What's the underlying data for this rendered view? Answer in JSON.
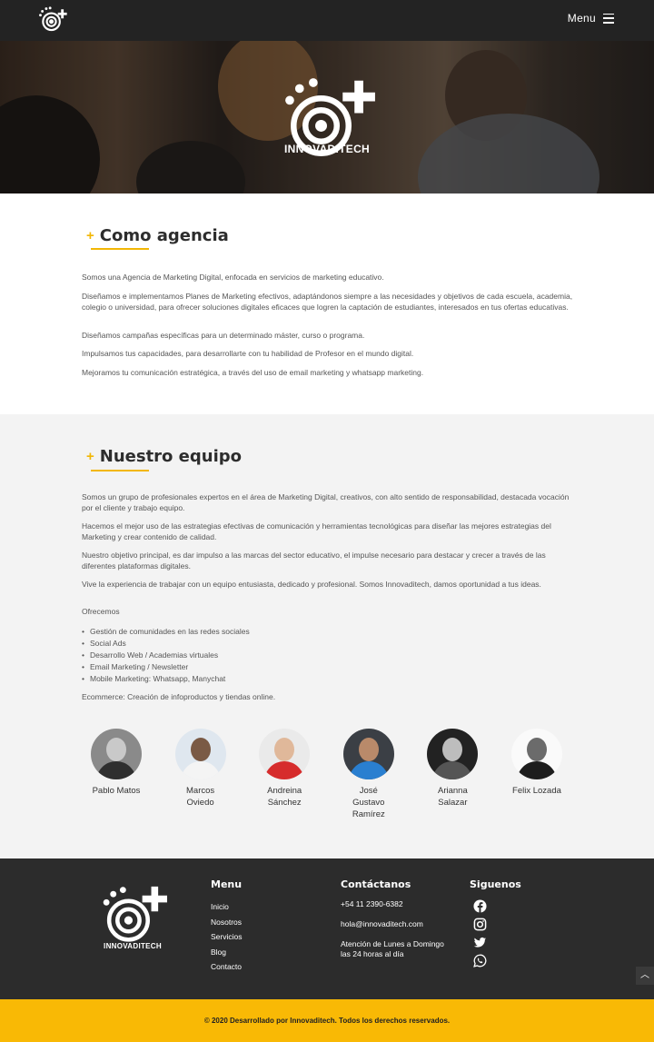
{
  "header": {
    "menu_label": "Menu"
  },
  "hero": {
    "brand": "INNOVADITECH"
  },
  "about": {
    "title": "Como agencia",
    "paragraphs": [
      "Somos una Agencia de Marketing Digital, enfocada en servicios de marketing educativo.",
      "Diseñamos e implementamos Planes de Marketing efectivos, adaptándonos siempre a las necesidades y objetivos de cada escuela, academia, colegio o universidad, para ofrecer soluciones digitales eficaces que logren la captación de estudiantes, interesados en tus ofertas educativas.",
      "Diseñamos campañas específicas para un determinado máster, curso o programa.",
      "Impulsamos tus capacidades, para desarrollarte con tu habilidad de Profesor en el mundo digital.",
      "Mejoramos tu comunicación estratégica, a través del uso de email marketing y whatsapp marketing."
    ]
  },
  "team": {
    "title": "Nuestro equipo",
    "paragraphs": [
      "Somos un grupo de profesionales expertos en el área de Marketing Digital, creativos, con alto sentido de responsabilidad, destacada vocación por el cliente y trabajo equipo.",
      "Hacemos el mejor uso de las estrategias efectivas de comunicación y herramientas tecnológicas para diseñar las mejores estrategias del Marketing y crear contenido de calidad.",
      "Nuestro objetivo principal, es dar impulso a las marcas del sector educativo, el impulse necesario para destacar y crecer a través de las diferentes plataformas digitales.",
      "Vive la experiencia de trabajar con un equipo entusiasta, dedicado y profesional. Somos Innovaditech, damos oportunidad a tus ideas."
    ],
    "offer_title": "Ofrecemos",
    "offer_items": [
      "Gestión de comunidades en las redes sociales",
      "Social Ads",
      "Desarrollo Web / Academias virtuales",
      "Email Marketing / Newsletter",
      "Mobile Marketing: Whatsapp, Manychat"
    ],
    "ecommerce": "Ecommerce: Creación de infoproductos y tiendas online.",
    "members": [
      {
        "name": "Pablo Matos"
      },
      {
        "name": "Marcos Oviedo"
      },
      {
        "name": "Andreina Sánchez"
      },
      {
        "name": "José Gustavo Ramírez"
      },
      {
        "name": "Arianna Salazar"
      },
      {
        "name": "Felix Lozada"
      }
    ]
  },
  "footer": {
    "brand": "INNOVADITECH",
    "menu_title": "Menu",
    "menu_items": [
      "Inicio",
      "Nosotros",
      "Servicios",
      "Blog",
      "Contacto"
    ],
    "contact_title": "Contáctanos",
    "phone": "+54 11 2390-6382",
    "email": "hola@innovaditech.com",
    "hours": "Atención de Lunes a Domingo las 24 horas al día",
    "social_title": "Siguenos",
    "social_icons": [
      "facebook-icon",
      "instagram-icon",
      "twitter-icon",
      "whatsapp-icon"
    ],
    "copyright": "© 2020 Desarrollado por Innovaditech. Todos los derechos reservados."
  },
  "colors": {
    "accent": "#f9b905",
    "header_bg": "#232323",
    "footer_bg": "#2c2c2c",
    "team_bg": "#f3f3f3"
  }
}
